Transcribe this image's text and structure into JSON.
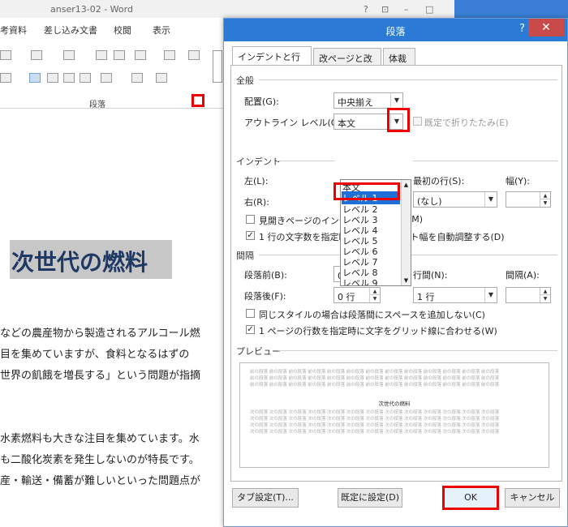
{
  "word": {
    "title": "anser13-02 - Word",
    "title_controls": [
      "?",
      "⊡",
      "–",
      "□"
    ],
    "tabs": [
      "考資料",
      "差し込み文書",
      "校閲",
      "表示"
    ],
    "ribbon_group_label": "段落",
    "heading": "次世代の燃料",
    "body_lines": [
      "などの農産物から製造されるアルコール燃",
      "目を集めていますが、食料となるはずの",
      "世界の飢餓を増長する」という問題が指摘",
      "水素燃料も大きな注目を集めています。水",
      "も二酸化炭素を発生しないのが特長です。",
      "産・輸送・備蓄が難しいといった問題点が"
    ]
  },
  "dialog": {
    "title": "段落",
    "help": "?",
    "close": "✕",
    "tabs": [
      "インデントと行間隔",
      "改ページと改行",
      "体裁"
    ],
    "general": {
      "section": "全般",
      "alignment_label": "配置(G):",
      "alignment_value": "中央揃え",
      "outline_label": "アウトライン レベル(O):",
      "outline_value": "本文",
      "collapse_label": "既定で折りたたみ(E)"
    },
    "dropdown_items": [
      "本文",
      "レベル 1",
      "レベル 2",
      "レベル 3",
      "レベル 4",
      "レベル 5",
      "レベル 6",
      "レベル 7",
      "レベル 8",
      "レベル 9"
    ],
    "dropdown_selected": "レベル 1",
    "indent": {
      "section": "インデント",
      "left_label": "左(L):",
      "right_label": "右(R):",
      "first_line_label": "最初の行(S):",
      "first_line_value": "(なし)",
      "width_label": "幅(Y):",
      "mirror_label": "見開きページのインデ",
      "mirror_tail": "(M)",
      "auto_adjust_label": "1 行の文字数を指定時に右のインデント幅を自動調整する(D)"
    },
    "spacing": {
      "section": "間隔",
      "before_label": "段落前(B):",
      "before_value": "0 行",
      "after_label": "段落後(F):",
      "after_value": "0 行",
      "line_spacing_label": "行間(N):",
      "line_spacing_value": "1 行",
      "at_label": "間隔(A):",
      "no_space_label": "同じスタイルの場合は段落間にスペースを追加しない(C)",
      "grid_label": "1 ページの行数を指定時に文字をグリッド線に合わせる(W)"
    },
    "preview": {
      "section": "プレビュー",
      "before_text": "前の段落 前の段落 前の段落 前の段落 前の段落 前の段落 前の段落 前の段落 前の段落 前の段落 前の段落 前の段落 前の段落",
      "sample_title": "次世代の燃料",
      "after_text": "次の段落 次の段落 次の段落 次の段落 次の段落 次の段落 次の段落 次の段落 次の段落 次の段落 次の段落 次の段落 次の段落"
    },
    "buttons": {
      "tabs": "タブ設定(T)...",
      "default": "既定に設定(D)",
      "ok": "OK",
      "cancel": "キャンセル"
    }
  }
}
